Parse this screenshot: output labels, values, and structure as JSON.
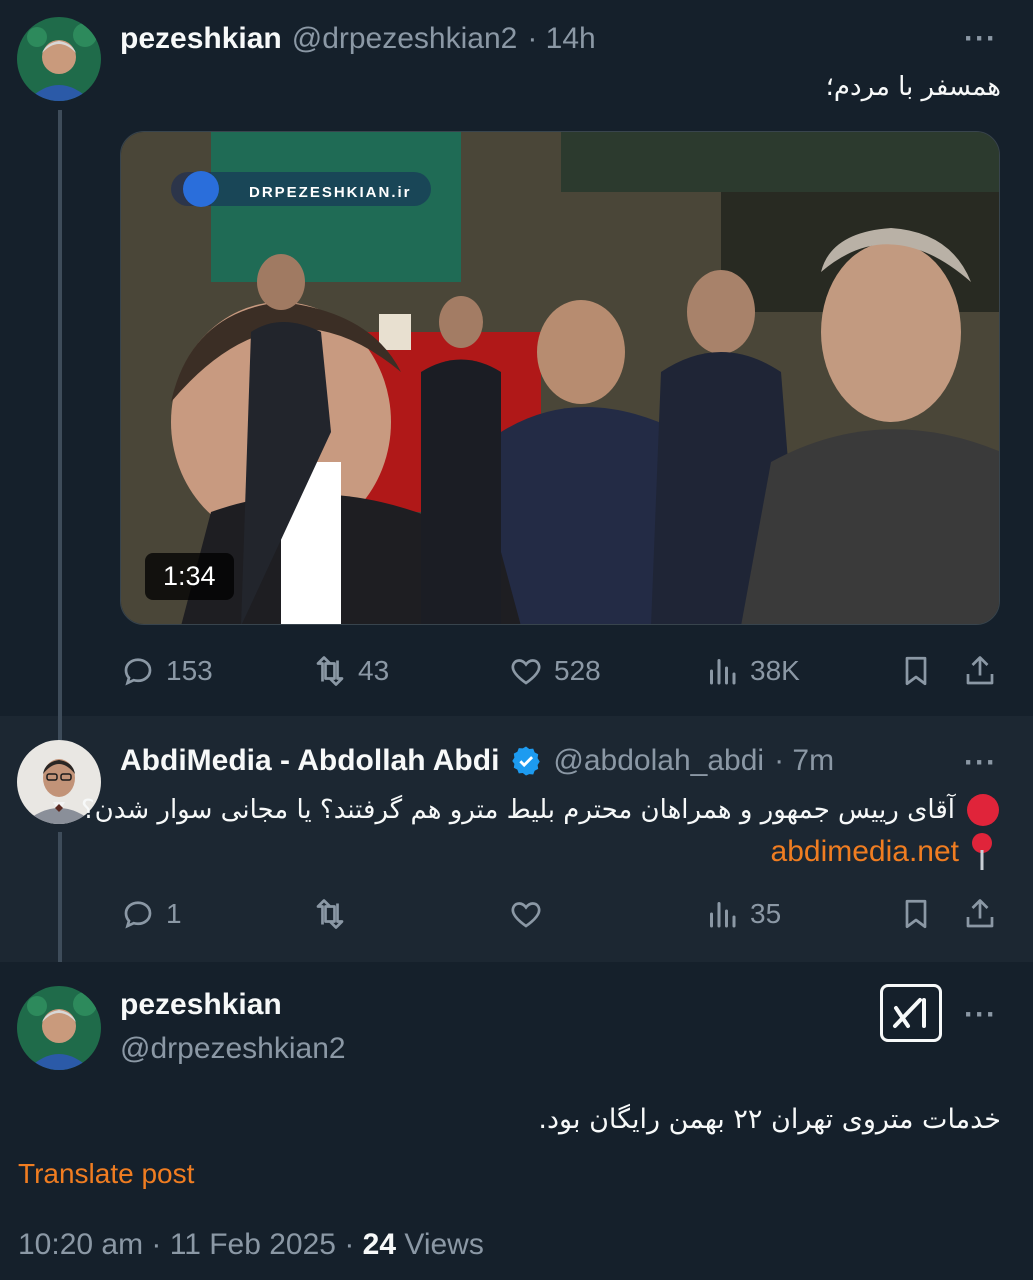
{
  "tweet1": {
    "name": "pezeshkian",
    "handle": "@drpezeshkian2",
    "time": "· 14h",
    "more": "···",
    "text": "همسفر با مردم؛",
    "media": {
      "watermark": "DRPEZESHKIAN.ir",
      "duration": "1:34"
    },
    "actions": {
      "replies": "153",
      "reposts": "43",
      "likes": "528",
      "views": "38K"
    }
  },
  "tweet2": {
    "name": "AbdiMedia - Abdollah Abdi",
    "handle": "@abdolah_abdi",
    "time": "· 7m",
    "more": "···",
    "text": "آقای رییس جمهور و همراهان محترم بلیط مترو هم گرفتند؟ یا مجانی سوار شدن؟",
    "link": "abdimedia.net",
    "actions": {
      "replies": "1",
      "reposts": "",
      "likes": "",
      "views": "35"
    }
  },
  "tweet3": {
    "name": "pezeshkian",
    "handle": "@drpezeshkian2",
    "more": "···",
    "text": "خدمات متروی تهران ۲۲ بهمن رایگان بود.",
    "translate": "Translate post",
    "timestamp": "10:20 am · 11 Feb 2025 · ",
    "views_count": "24",
    "views_label": " Views"
  },
  "colors": {
    "background": "#15202b",
    "reply_background": "#1c2732",
    "accent_orange": "#f07d21",
    "muted": "#8b98a5",
    "verified_blue": "#1d9bf0"
  }
}
